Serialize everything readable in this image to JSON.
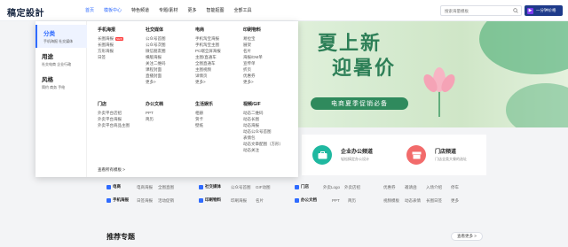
{
  "header": {
    "logo": "稿定設計",
    "nav": [
      "首页",
      "模板中心",
      "特色频道",
      "专题/素材",
      "更多",
      "智能抠图",
      "全部工具"
    ],
    "search_placeholder": "搜索海量模板",
    "vip_label": "一分钟价格"
  },
  "dropdown": {
    "side": [
      {
        "title": "分类",
        "sub": "手机海报  社交媒体"
      },
      {
        "title": "用途",
        "sub": "社交电商  企业行政"
      },
      {
        "title": "风格",
        "sub": "简约  商务  手绘"
      }
    ],
    "columns": [
      {
        "title": "手机海报",
        "items": [
          "长图海报",
          "长图海报",
          "方形海报",
          "日签"
        ],
        "new_index": 0
      },
      {
        "title": "社交媒体",
        "items": [
          "公众号首图",
          "公众号次图",
          "微信朋友圈",
          "横版海报",
          "关注二维码",
          "课程封面",
          "直播封面",
          "更多>"
        ]
      },
      {
        "title": "电商",
        "items": [
          "手机淘宝海报",
          "手机淘宝主图",
          "PC端全屏海报",
          "主图/直通车",
          "全图直通车",
          "主图视频",
          "详情页",
          "更多>"
        ]
      },
      {
        "title": "印刷物料",
        "items": [
          "易拉宝",
          "展架",
          "名片",
          "海报/DM单",
          "宣传单",
          "折页",
          "优惠券",
          "更多>"
        ]
      },
      {
        "title": "门店",
        "items": [
          "外卖平台店招",
          "外卖平台海报",
          "外卖平台商品主图"
        ]
      },
      {
        "title": "办公文档",
        "items": [
          "PPT",
          "简历"
        ]
      },
      {
        "title": "生活娱乐",
        "items": [
          "相册",
          "贺卡",
          "壁纸"
        ]
      },
      {
        "title": "视频/GIF",
        "items": [
          "动态二维码",
          "动态长图",
          "动态海报",
          "动态公众号首图",
          "表情包",
          "动态文章配图（方形）",
          "动态关注"
        ]
      }
    ],
    "footer": "查看所有模板 >"
  },
  "banner": {
    "title_line1": "夏上新",
    "title_line2": "迎暑价",
    "pill": "电商夏季促销必备"
  },
  "cards": [
    {
      "title": "企业办公频道",
      "sub": "轻松搞定办公设计",
      "color": "#1fb8a0"
    },
    {
      "title": "门店频道",
      "sub": "门店全类大餐的选址",
      "color": "#f26b6b"
    }
  ],
  "cat_rows": [
    {
      "head": "电商",
      "links": [
        "电商海报",
        "全图直图"
      ],
      "head2": "社交媒体",
      "links2": [
        "公众号首图",
        "GIF动图"
      ],
      "head3": "门店",
      "links3": [
        "外卖Logo",
        "外卖店招"
      ],
      "links4": [
        "优惠券",
        "邀请函",
        "入场介绍",
        "停车"
      ]
    },
    {
      "head": "手机海报",
      "links": [
        "日签海报",
        "活动促销"
      ],
      "head2": "印刷物料",
      "links2": [
        "印刷海报",
        "名片"
      ],
      "head3": "办公文档",
      "links3": [
        "PPT",
        "简历"
      ],
      "links4": [
        "视频模板",
        "动态表情",
        "长图日签",
        "更多"
      ]
    }
  ],
  "recommend": {
    "title": "推荐专题",
    "more": "查看更多 >"
  },
  "colors": {
    "accent": "#2f6bff",
    "banner_green": "#2d7f57",
    "dark_blue": "#1e3a8a"
  }
}
